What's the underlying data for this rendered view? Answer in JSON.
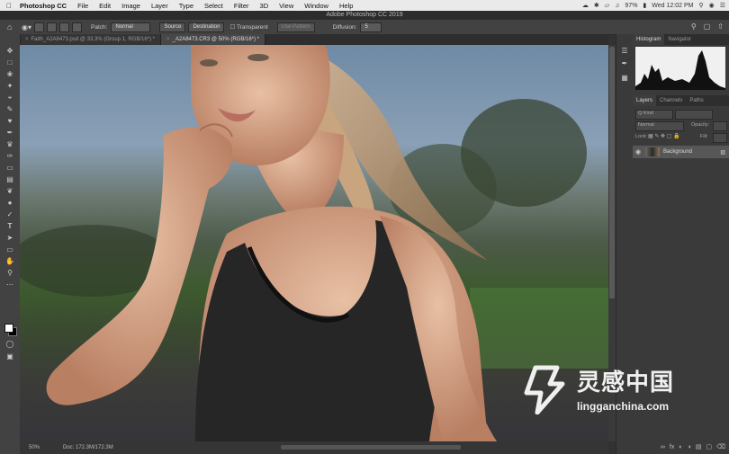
{
  "menubar": {
    "items": [
      "Photoshop CC",
      "File",
      "Edit",
      "Image",
      "Layer",
      "Type",
      "Select",
      "Filter",
      "3D",
      "View",
      "Window",
      "Help"
    ],
    "battery": "97%",
    "clock": "Wed 12:02 PM"
  },
  "window_title": "Adobe Photoshop CC 2019",
  "options": {
    "tool_label": "Patch:",
    "mode_value": "Normal",
    "source_label": "Source",
    "destination_label": "Destination",
    "transparent_label": "Transparent",
    "use_pattern_label": "Use Pattern",
    "diffusion_label": "Diffusion:",
    "diffusion_value": "5"
  },
  "document_tabs": [
    {
      "label": "Faith_A2A8473.psd @ 33.3% (Group 1, RGB/16*) *",
      "active": false
    },
    {
      "label": "_A2A8473.CR3 @ 50% (RGB/16*) *",
      "active": true
    }
  ],
  "status": {
    "zoom": "50%",
    "doc": "Doc: 172.3M/172.3M"
  },
  "panels": {
    "top_tabs": [
      "Histogram",
      "Navigator"
    ],
    "layer_tabs": [
      "Layers",
      "Channels",
      "Paths"
    ],
    "kind_placeholder": "Q Kind",
    "blend_mode": "Normal",
    "opacity_label": "Opacity:",
    "lock_label": "Lock:",
    "fill_label": "Fill:",
    "layers": [
      {
        "name": "Background"
      }
    ]
  },
  "watermark": {
    "cn": "灵感中国",
    "en": "lingganchina.com"
  }
}
